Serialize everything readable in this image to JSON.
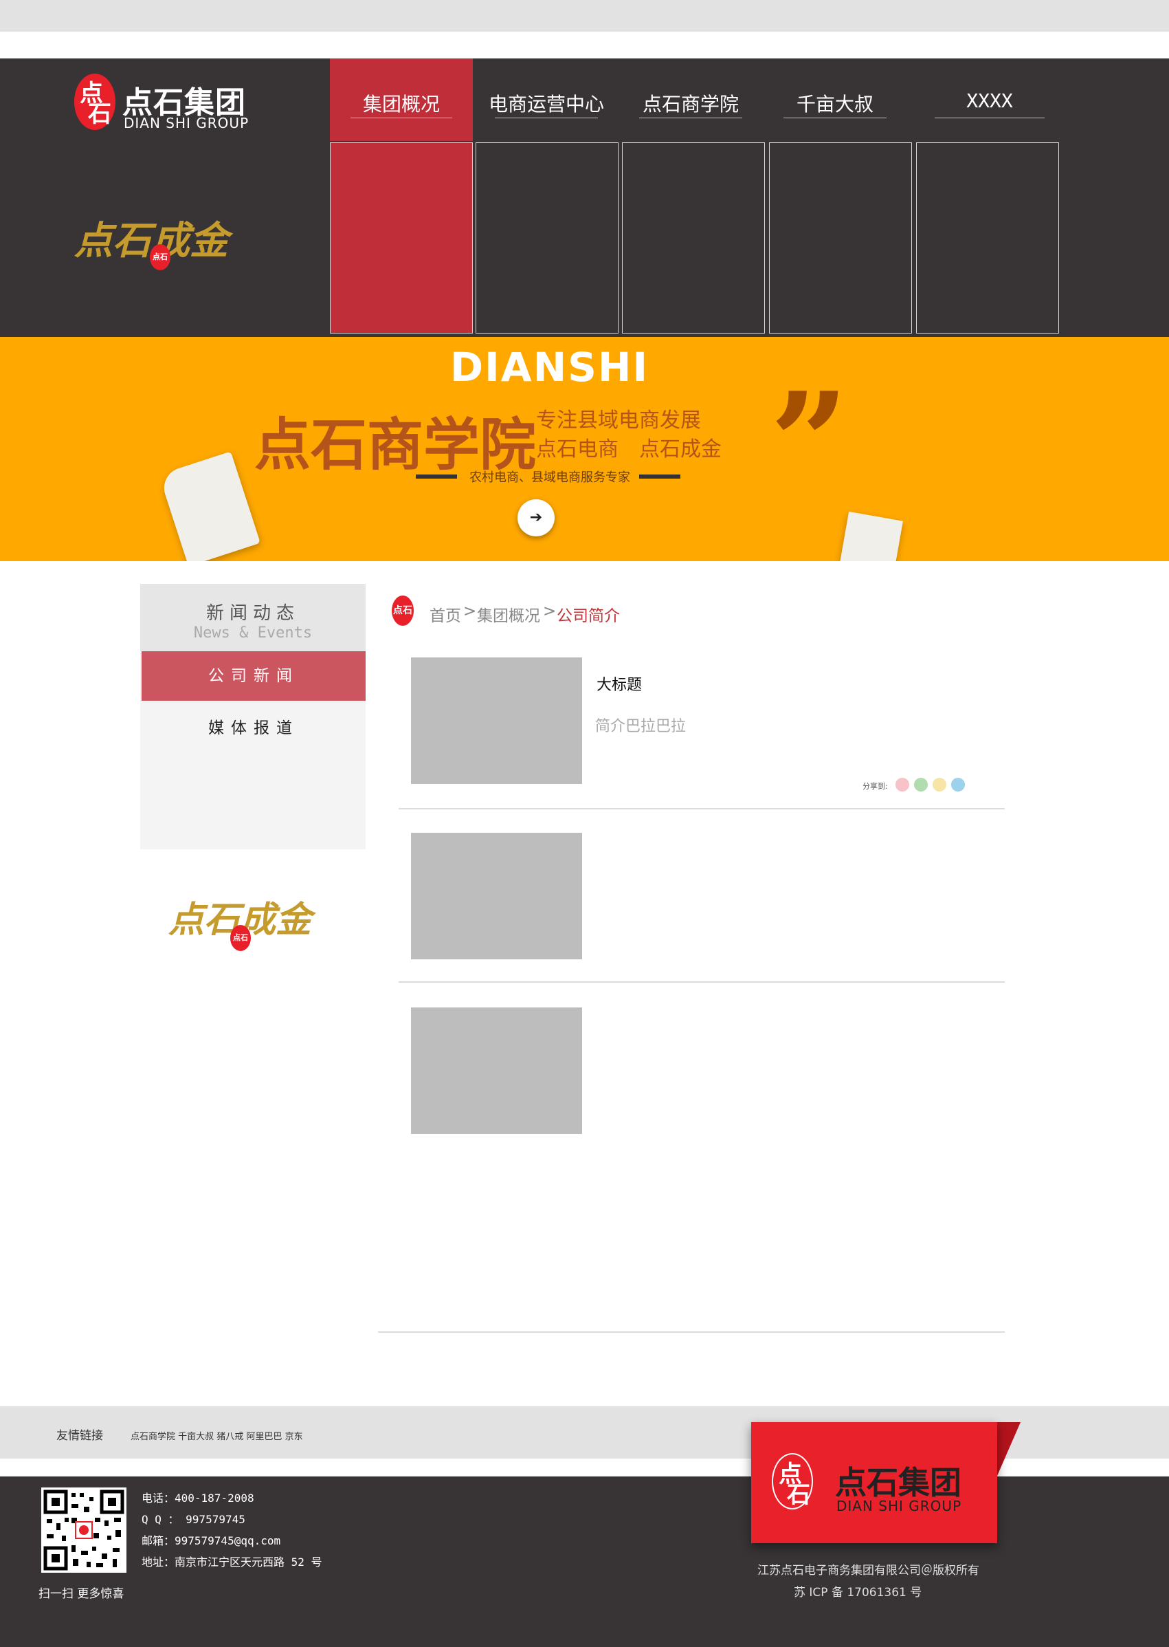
{
  "header": {
    "logo_seal_top": "点",
    "logo_seal_bottom": "石",
    "logo_cn": "点石集团",
    "logo_en": "DIAN SHI GROUP",
    "slogan": "点石成金",
    "slogan_seal": "点石"
  },
  "nav": {
    "items": [
      {
        "label": "集团概况"
      },
      {
        "label": "电商运营中心"
      },
      {
        "label": "点石商学院"
      },
      {
        "label": "千亩大叔"
      },
      {
        "label": "XXXX"
      }
    ],
    "active_color": "#c02e3a"
  },
  "banner": {
    "top_word": "DIANSHI",
    "title": "点石商学院",
    "line1": "专注县域电商发展",
    "line2": "点石电商　点石成金",
    "tagline": "农村电商、县域电商服务专家",
    "quote_mark": "”",
    "arrow": "➔",
    "bg_color": "#ffa800"
  },
  "sidebar": {
    "title": "新闻动态",
    "subtitle": "News & Events",
    "items": [
      {
        "label": "公司新闻",
        "active": true
      },
      {
        "label": "媒体报道",
        "active": false
      }
    ],
    "slogan": "点石成金",
    "slogan_seal": "点石"
  },
  "breadcrumb": {
    "seal": "点石",
    "home": "首页",
    "sep": ">",
    "level1": "集团概况",
    "current": "公司简介"
  },
  "articles": [
    {
      "title": "大标题",
      "summary": "简介巴拉巴拉",
      "share_label": "分享到:"
    },
    {
      "title": "",
      "summary": ""
    },
    {
      "title": "",
      "summary": ""
    }
  ],
  "share_icons": [
    "weibo-icon",
    "wechat-icon",
    "qzone-icon",
    "tencent-weibo-icon"
  ],
  "links_bar": {
    "label": "友情链接",
    "links": [
      "点石商学院",
      "千亩大叔",
      "猪八戒",
      "阿里巴巴",
      "京东"
    ]
  },
  "footer": {
    "qr_caption": "扫一扫 更多惊喜",
    "phone": "电话：400-187-2008",
    "qq": "Q Q ： 997579745",
    "email": "邮箱：997579745@qq.com",
    "address": "地址：南京市江宁区天元西路 52 号",
    "brand_cn": "点石集团",
    "brand_en": "DIAN SHI GROUP",
    "brand_seal_top": "点",
    "brand_seal_bottom": "石",
    "copyright": "江苏点石电子商务集团有限公司＠版权所有",
    "icp": "苏 ICP 备 17061361 号"
  }
}
